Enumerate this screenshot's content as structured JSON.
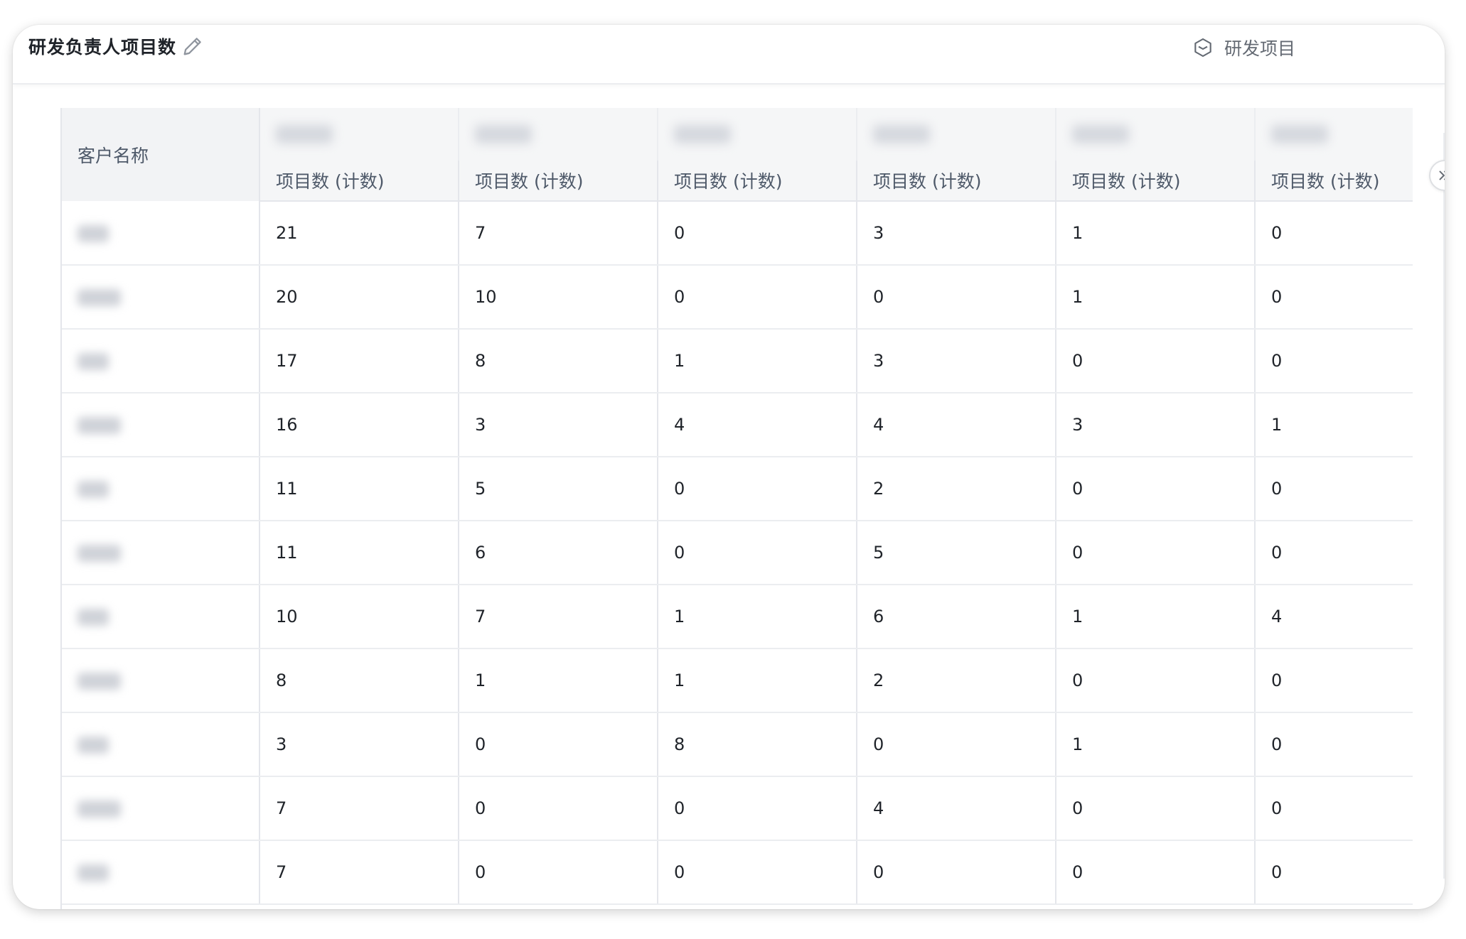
{
  "header": {
    "title": "研发负责人项目数",
    "source_label": "研发项目"
  },
  "table": {
    "name_column_header": "客户名称",
    "metric_label": "项目数 (计数)",
    "metric_columns": 6,
    "rows": [
      [
        21,
        7,
        0,
        3,
        1,
        0
      ],
      [
        20,
        10,
        0,
        0,
        1,
        0
      ],
      [
        17,
        8,
        1,
        3,
        0,
        0
      ],
      [
        16,
        3,
        4,
        4,
        3,
        1
      ],
      [
        11,
        5,
        0,
        2,
        0,
        0
      ],
      [
        11,
        6,
        0,
        5,
        0,
        0
      ],
      [
        10,
        7,
        1,
        6,
        1,
        4
      ],
      [
        8,
        1,
        1,
        2,
        0,
        0
      ],
      [
        3,
        0,
        8,
        0,
        1,
        0
      ],
      [
        7,
        0,
        0,
        4,
        0,
        0
      ],
      [
        7,
        0,
        0,
        0,
        0,
        0
      ]
    ]
  },
  "icons": {
    "edit": "pencil-icon",
    "source": "layers-icon",
    "expand": "double-chevron-right-icon"
  },
  "colors": {
    "header_bg": "#f5f6f7",
    "border": "#e4e6eb",
    "text_primary": "#1f2329",
    "text_secondary": "#4e5969"
  }
}
